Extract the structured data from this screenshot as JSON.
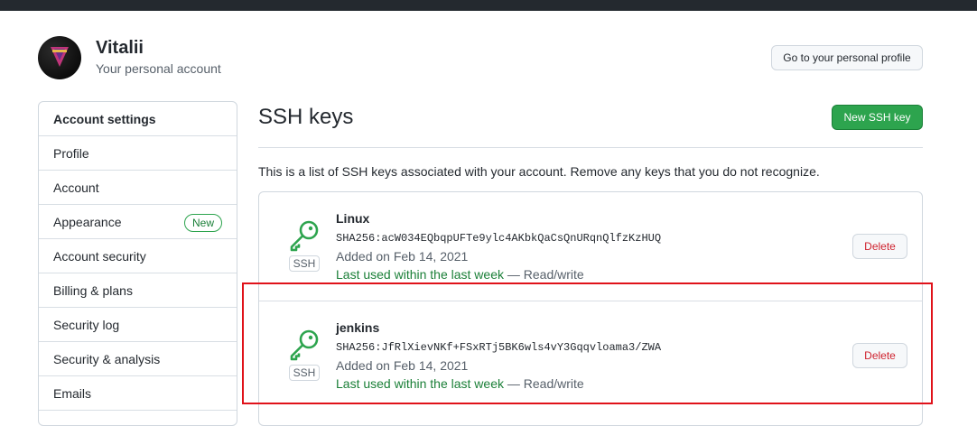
{
  "colors": {
    "accent_green": "#2da44e",
    "danger_red": "#cf222e",
    "highlight_red": "#e0121a",
    "topbar": "#24292f"
  },
  "header": {
    "name": "Vitalii",
    "subtitle": "Your personal account",
    "profile_button": "Go to your personal profile"
  },
  "sidebar": {
    "items": [
      {
        "label": "Account settings",
        "header": true
      },
      {
        "label": "Profile"
      },
      {
        "label": "Account"
      },
      {
        "label": "Appearance",
        "badge": "New"
      },
      {
        "label": "Account security"
      },
      {
        "label": "Billing & plans"
      },
      {
        "label": "Security log"
      },
      {
        "label": "Security & analysis"
      },
      {
        "label": "Emails"
      }
    ]
  },
  "main": {
    "title": "SSH keys",
    "new_button": "New SSH key",
    "intro": "This is a list of SSH keys associated with your account. Remove any keys that you do not recognize.",
    "keys": [
      {
        "title": "Linux",
        "fingerprint": "SHA256:acW034EQbqpUFTe9ylc4AKbkQaCsQnURqnQlfzKzHUQ",
        "added": "Added on Feb 14, 2021",
        "last_used": "Last used within the last week",
        "access": " — Read/write",
        "type_label": "SSH",
        "icon": "key-icon",
        "delete_label": "Delete"
      },
      {
        "title": "jenkins",
        "fingerprint": "SHA256:JfRlXievNKf+FSxRTj5BK6wls4vY3Gqqvloama3/ZWA",
        "added": "Added on Feb 14, 2021",
        "last_used": "Last used within the last week",
        "access": " — Read/write",
        "type_label": "SSH",
        "icon": "key-icon",
        "delete_label": "Delete"
      }
    ]
  }
}
